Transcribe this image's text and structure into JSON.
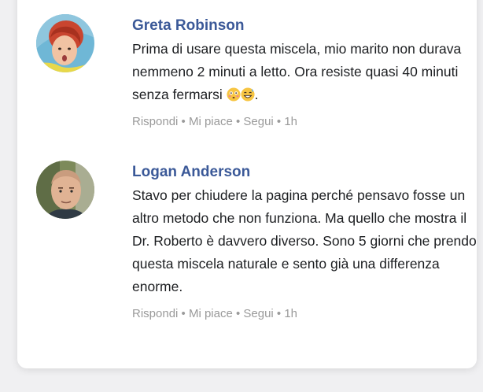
{
  "comments": [
    {
      "author": "Greta Robinson",
      "text": "Prima di usare questa miscela, mio marito non durava nemmeno 2 minuti a letto. Ora resiste quasi 40 minuti senza fermarsi",
      "text_suffix": ".",
      "emojis": [
        "flushed-face",
        "grinning-sweat-face"
      ],
      "actions": "Rispondi • Mi piace • Segui • 1h",
      "avatar": "woman-avatar"
    },
    {
      "author": "Logan Anderson",
      "text": "Stavo per chiudere la pagina perché pensavo fosse un altro metodo che non funziona. Ma quello che mostra il Dr. Roberto è davvero diverso. Sono 5 giorni che prendo questa miscela naturale e sento già una differenza enorme.",
      "actions": "Rispondi • Mi piace • Segui • 1h",
      "avatar": "man-avatar"
    }
  ],
  "colors": {
    "author": "#3b5998",
    "body_text": "#1c1e21",
    "meta_text": "#9a9a9a",
    "card_bg": "#ffffff",
    "page_bg": "#f0f0f2"
  }
}
